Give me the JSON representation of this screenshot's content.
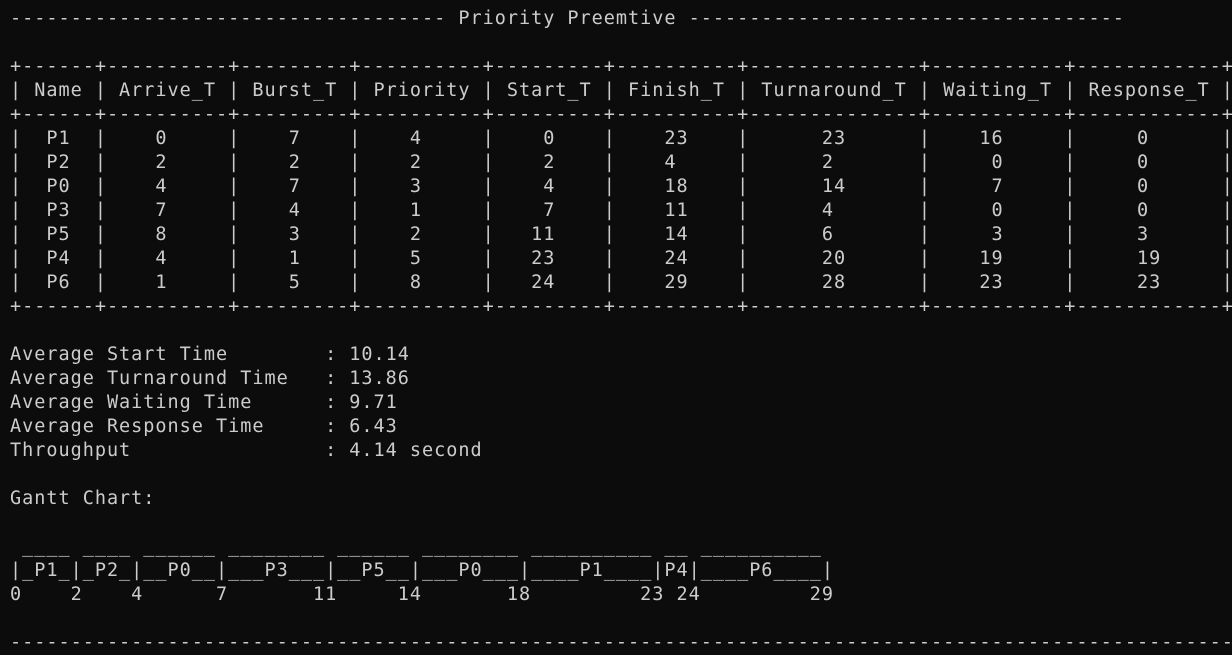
{
  "terminal": {
    "colors": {
      "background": "#0c0c0c",
      "foreground": "#cccccc"
    },
    "lines": [
      "------------------------------------ Priority Preemtive ------------------------------------",
      "",
      "+------+----------+---------+----------+---------+----------+--------------+-----------+------------+",
      "| Name | Arrive_T | Burst_T | Priority | Start_T | Finish_T | Turnaround_T | Waiting_T | Response_T |",
      "+------+----------+---------+----------+---------+----------+--------------+-----------+------------+",
      "|  P1  |    0     |    7    |    4     |    0    |    23    |      23      |    16     |     0      |",
      "|  P2  |    2     |    2    |    2     |    2    |    4     |      2       |     0     |     0      |",
      "|  P0  |    4     |    7    |    3     |    4    |    18    |      14      |     7     |     0      |",
      "|  P3  |    7     |    4    |    1     |    7    |    11    |      4       |     0     |     0      |",
      "|  P5  |    8     |    3    |    2     |   11    |    14    |      6       |     3     |     3      |",
      "|  P4  |    4     |    1    |    5     |   23    |    24    |      20      |    19     |     19     |",
      "|  P6  |    1     |    5    |    8     |   24    |    29    |      28      |    23     |     23     |",
      "+------+----------+---------+----------+---------+----------+--------------+-----------+------------+",
      "",
      "Average Start Time        : 10.14",
      "Average Turnaround Time   : 13.86",
      "Average Waiting Time      : 9.71",
      "Average Response Time     : 6.43",
      "Throughput                : 4.14 second",
      "",
      "Gantt Chart:",
      "",
      " ____ ____ ______ ________ ______ ________ __________ __ __________",
      "|_P1_|_P2_|__P0__|___P3___|__P5__|___P0___|____P1____|P4|____P6____|",
      "0    2    4      7       11     14       18         23 24         29",
      "",
      "-----------------------------------------------------------------------------------------------------"
    ]
  }
}
